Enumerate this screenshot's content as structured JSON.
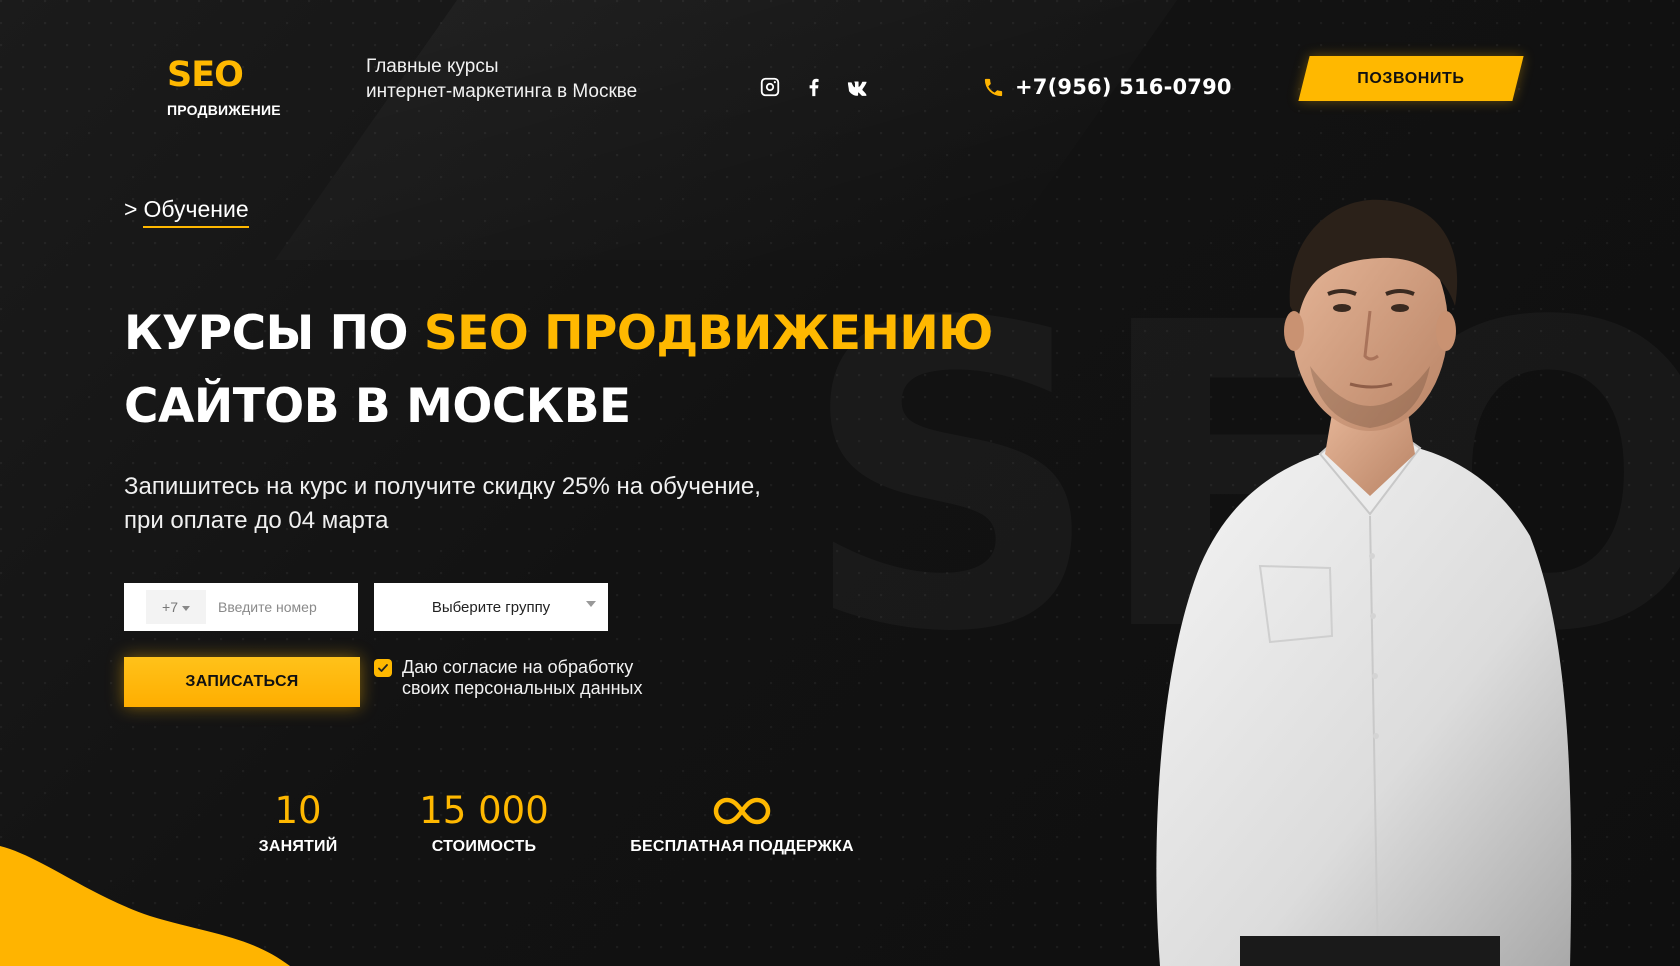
{
  "colors": {
    "accent": "#ffb800",
    "background": "#121212",
    "text": "#ffffff"
  },
  "background_watermark": "SEO",
  "header": {
    "logo_main": "SEO",
    "logo_sub": "ПРОДВИЖЕНИЕ",
    "tagline_line1": "Главные курсы",
    "tagline_line2": "интернет-маркетинга в Москве",
    "socials": [
      {
        "name": "instagram",
        "icon": "instagram-icon"
      },
      {
        "name": "facebook",
        "icon": "facebook-icon"
      },
      {
        "name": "vk",
        "icon": "vk-icon"
      }
    ],
    "phone": "+7(956) 516-0790",
    "call_button": "ПОЗВОНИТЬ"
  },
  "hero": {
    "breadcrumb_arrow": ">",
    "breadcrumb_link": "Обучение",
    "headline_part1": "КУРСЫ ПО ",
    "headline_accent": "SEO ПРОДВИЖЕНИЮ",
    "headline_line2": "САЙТОВ В МОСКВЕ",
    "subtitle_line1": "Запишитесь на курс и получите скидку 25% на обучение,",
    "subtitle_line2": "при оплате до 04 марта"
  },
  "form": {
    "country_code": "+7",
    "phone_placeholder": "Введите номер",
    "group_select_value": "Выберите группу",
    "submit_button": "ЗАПИСАТЬСЯ",
    "consent_checked": true,
    "consent_line1": "Даю согласие на обработку",
    "consent_line2": "своих персональных данных"
  },
  "stats": [
    {
      "value": "10",
      "label": "ЗАНЯТИЙ"
    },
    {
      "value": "15 000",
      "label": "СТОИМОСТЬ"
    },
    {
      "value": "",
      "icon": "infinity-icon",
      "label": "БЕСПЛАТНАЯ ПОДДЕРЖКА"
    }
  ]
}
